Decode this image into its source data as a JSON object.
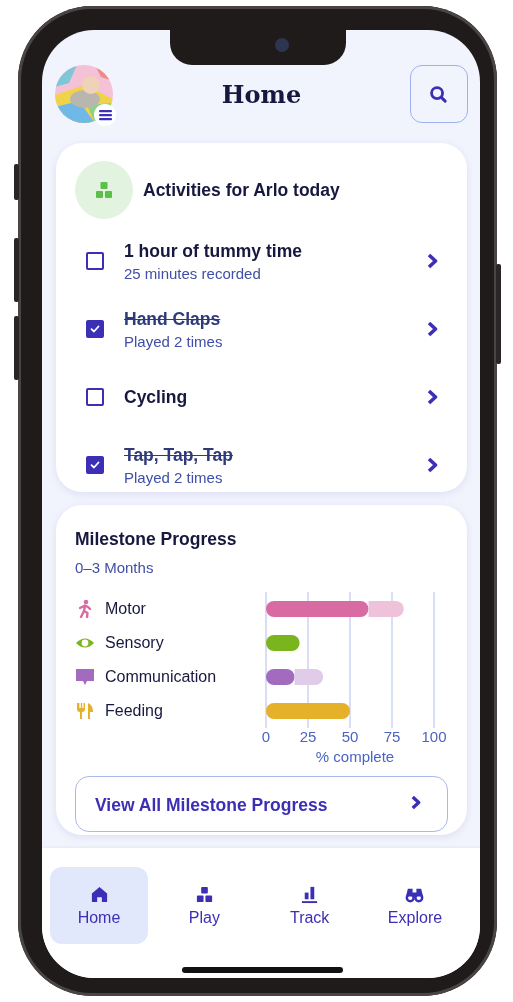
{
  "header": {
    "title": "Home"
  },
  "activities": {
    "title": "Activities for Arlo today",
    "items": [
      {
        "title": "1 hour of tummy time",
        "detail": "25 minutes recorded",
        "checked": false
      },
      {
        "title": "Hand Claps",
        "detail": "Played 2 times",
        "checked": true
      },
      {
        "title": "Cycling",
        "checked": false
      },
      {
        "title": "Tap, Tap, Tap",
        "detail": "Played 2 times",
        "checked": true
      }
    ]
  },
  "milestones": {
    "title": "Milestone Progress",
    "subtitle": "0–3 Months",
    "chart_data": {
      "type": "bar",
      "orientation": "horizontal",
      "stacked": true,
      "categories": [
        "Motor",
        "Sensory",
        "Communication",
        "Feeding"
      ],
      "grid": true,
      "series": [
        {
          "colors": [
            "#d96ba3",
            "#7ab51d",
            "#a26bbd",
            "#e6b12a"
          ],
          "values": [
            61,
            20,
            17,
            50
          ]
        },
        {
          "colors": [
            "#efc2db",
            null,
            "#e0cbe9",
            null
          ],
          "values": [
            21,
            null,
            17,
            null
          ]
        }
      ],
      "xlim": [
        0,
        100
      ],
      "xticks": [
        0,
        25,
        50,
        75,
        100
      ],
      "xlabel": "% complete"
    },
    "button": "View All Milestone Progress"
  },
  "nav": [
    {
      "label": "Home",
      "selected": true
    },
    {
      "label": "Play",
      "selected": false
    },
    {
      "label": "Track",
      "selected": false
    },
    {
      "label": "Explore",
      "selected": false
    }
  ]
}
